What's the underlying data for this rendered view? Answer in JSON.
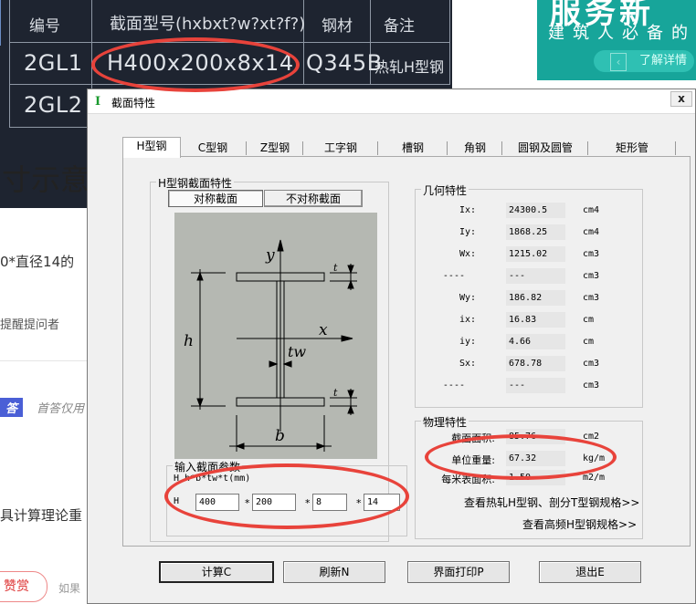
{
  "cad": {
    "headers": [
      "编号",
      "截面型号(hxbxt?w?xt?f?)",
      "钢材",
      "备注"
    ],
    "rows": [
      {
        "id": "2GL1",
        "section": "H400x200x8x14",
        "material": "Q345B",
        "note": "热轧H型钢"
      },
      {
        "id": "2GL2",
        "section": "",
        "material": "",
        "note": ""
      }
    ]
  },
  "page": {
    "heading": "寸示意",
    "line1": "0*直径14的",
    "remind": "提醒提问者",
    "badge": "答",
    "best": "首答仅用",
    "line2": "具计算理论重",
    "reward": "赞赏",
    "if_text": "如果"
  },
  "ad": {
    "title": "服务新",
    "subtitle": "建筑人必备的",
    "button": "了解详情"
  },
  "dialog": {
    "title": "截面特性",
    "close": "x",
    "tabs": [
      "H型钢",
      "C型钢",
      "Z型钢",
      "工字钢",
      "槽钢",
      "角钢",
      "圆钢及圆管",
      "矩形管"
    ],
    "selected_tab": "H型钢",
    "section_group": "H型钢截面特性",
    "sym_button": "对称截面",
    "asym_button": "不对称截面",
    "input_group": "输入截面参数",
    "formula": "H  h*b*tw*t(mm)",
    "h_label": "H",
    "inputs": {
      "h": "400",
      "b": "200",
      "tw": "8",
      "t": "14"
    },
    "star": "*",
    "geometry_group": "几何特性",
    "geometry": [
      {
        "name": "Ix:",
        "value": "24300.5",
        "unit": "cm4"
      },
      {
        "name": "Iy:",
        "value": "1868.25",
        "unit": "cm4"
      },
      {
        "name": "Wx:",
        "value": "1215.02",
        "unit": "cm3"
      },
      {
        "name": "----",
        "value": "---",
        "unit": "cm3"
      },
      {
        "name": "Wy:",
        "value": "186.82",
        "unit": "cm3"
      },
      {
        "name": "ix:",
        "value": "16.83",
        "unit": "cm"
      },
      {
        "name": "iy:",
        "value": "4.66",
        "unit": "cm"
      },
      {
        "name": "Sx:",
        "value": "678.78",
        "unit": "cm3"
      },
      {
        "name": "----",
        "value": "---",
        "unit": "cm3"
      }
    ],
    "physical_group": "物理特性",
    "physical": [
      {
        "name": "截面面积:",
        "value": "85.76",
        "unit": "cm2"
      },
      {
        "name": "单位重量:",
        "value": "67.32",
        "unit": "kg/m"
      },
      {
        "name": "每米表面积:",
        "value": "1.50",
        "unit": "m2/m"
      }
    ],
    "link1": "查看热轧H型钢、剖分T型钢规格>>",
    "link2": "查看高频H型钢规格>>",
    "buttons": {
      "calc": "计算C",
      "refresh": "刷新N",
      "print": "界面打印P",
      "exit": "退出E"
    },
    "diagram_labels": {
      "y": "y",
      "x": "x",
      "h": "h",
      "b": "b",
      "tw": "tw",
      "t_top": "t",
      "t_bottom": "t"
    }
  },
  "colors": {
    "annotation": "#e8433b",
    "cad_bg": "#1e2430",
    "diagram_bg": "#b5b8b2",
    "ad_bg": "#17a59a"
  }
}
